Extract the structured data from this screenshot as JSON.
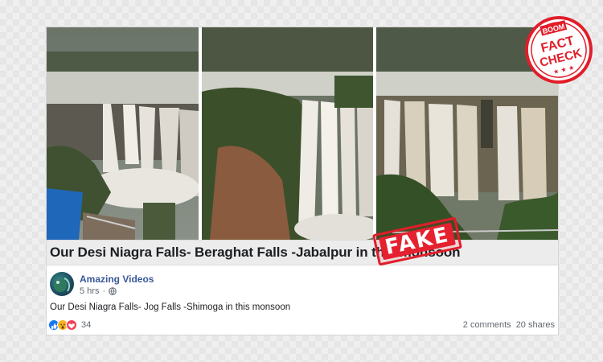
{
  "post": {
    "headline": "Our Desi Niagra Falls- Beraghat Falls -Jabalpur in this monsoon",
    "page_name": "Amazing Videos",
    "time": "5 hrs",
    "separator": "·",
    "text": "Our Desi Niagra Falls- Jog Falls -Shimoga in this monsoon",
    "reaction_count": "34",
    "comments": "2 comments",
    "shares": "20 shares"
  },
  "overlays": {
    "fake_label": "FAKE",
    "badge_top": "BOOM",
    "badge_line1": "FACT",
    "badge_line2": "CHECK",
    "badge_stars": "★ ★ ★"
  },
  "icons": {
    "privacy": "globe-icon",
    "reactions": [
      "like-icon",
      "wow-icon",
      "love-icon"
    ]
  },
  "colors": {
    "accent_red": "#e11d2a",
    "link_blue": "#385898",
    "like_blue": "#1877f2"
  }
}
